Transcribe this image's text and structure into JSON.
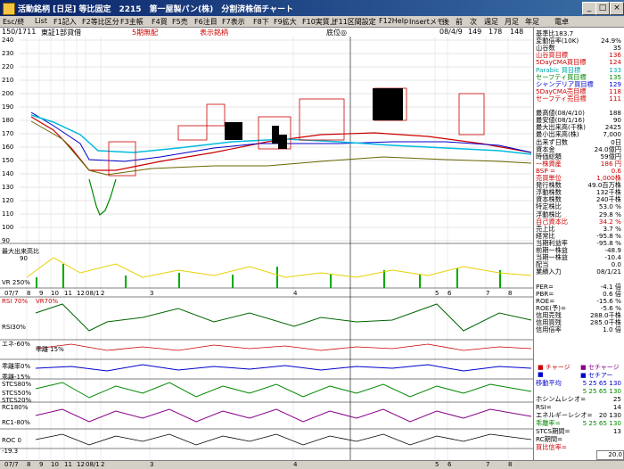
{
  "window": {
    "title": "活動銘柄 [日足] 等比固定　2215　第一屋製パン(株)　分割済株価チャート",
    "buttons": [
      "_",
      "□",
      "×"
    ]
  },
  "menu": [
    "Esc/終",
    "List",
    "F1記入",
    "F2等比区分",
    "F3主帳",
    "F4買",
    "F5売",
    "F6注目",
    "F7表示",
    "F8下",
    "F9拡大",
    "F10実質上",
    "F11区間設定",
    "F12Help",
    "Insertメモ",
    "後",
    "前",
    "次",
    "週足",
    "月足",
    "年足",
    "電卓"
  ],
  "infobar": {
    "count": "150/1711",
    "market": "東証1部貸借",
    "period": "5期無配",
    "display": "表示銘柄",
    "mark": "底位◎",
    "date": "08/4/9",
    "v1": "149",
    "v2": "178",
    "v3": "148",
    "v4": "176",
    "volume": "V:24,258,000"
  },
  "side": {
    "rows": [
      {
        "l": "基準比183.7",
        "v": "",
        "c": "#000000"
      },
      {
        "l": "変動倍率(10K)",
        "v": "24.9%",
        "c": "#000000"
      },
      {
        "l": "山谷数",
        "v": "35",
        "c": "#000000"
      },
      {
        "l": "山谷買目標",
        "v": "136",
        "c": "#cc0000"
      },
      {
        "l": "5DayCMA買目標",
        "v": "124",
        "c": "#cc0000"
      },
      {
        "l": "Parabic 買目標",
        "v": "133",
        "c": "#00aaaa"
      },
      {
        "l": "セーフティ買目標",
        "v": "135",
        "c": "#008800"
      },
      {
        "l": "シャンデリア買目標",
        "v": "129",
        "c": "#0000cc"
      },
      {
        "l": "5DayCMA売目標",
        "v": "118",
        "c": "#cc0000"
      },
      {
        "l": "セーフティ売目標",
        "v": "111",
        "c": "#cc0000"
      },
      {
        "l": "",
        "v": "",
        "c": "#000000"
      },
      {
        "l": "最高値(08/4/10)",
        "v": "188",
        "c": "#000000"
      },
      {
        "l": "最安値(08/1/16)",
        "v": "90",
        "c": "#000000"
      },
      {
        "l": "最大出来高(千株)",
        "v": "2425",
        "c": "#000000"
      },
      {
        "l": "最小出来高(株)",
        "v": "7,000",
        "c": "#000000"
      },
      {
        "l": "出来ず日数",
        "v": "0日",
        "c": "#000000"
      },
      {
        "l": "資本金",
        "v": "24.0億円",
        "c": "#000000"
      },
      {
        "l": "時価総額",
        "v": "59億円",
        "c": "#000000"
      },
      {
        "l": "一株資産",
        "v": "186 円",
        "c": "#cc0000"
      },
      {
        "l": "BSP =",
        "v": "0.6",
        "c": "#cc0000"
      },
      {
        "l": "売買単位",
        "v": "1,000株",
        "c": "#cc0000"
      },
      {
        "l": "発行株数",
        "v": "49.0百万株",
        "c": "#000000"
      },
      {
        "l": "浮動株数",
        "v": "132千株",
        "c": "#000000"
      },
      {
        "l": "資本株数",
        "v": "240千株",
        "c": "#000000"
      },
      {
        "l": "特定株比",
        "v": "53.0 %",
        "c": "#000000"
      },
      {
        "l": "浮動株比",
        "v": "29.8 %",
        "c": "#000000"
      },
      {
        "l": "自己資本比",
        "v": "34.2 %",
        "c": "#cc0000"
      },
      {
        "l": "売上比",
        "v": "3.7 %",
        "c": "#000000"
      },
      {
        "l": "経常比",
        "v": "-95.8 %",
        "c": "#000000"
      },
      {
        "l": "当期利益率",
        "v": "-95.8 %",
        "c": "#000000"
      },
      {
        "l": "前期一株益",
        "v": "-48.9",
        "c": "#000000"
      },
      {
        "l": "当期一株益",
        "v": "-10.4",
        "c": "#000000"
      },
      {
        "l": "配当",
        "v": "0.0",
        "c": "#000000"
      },
      {
        "l": "業績入力",
        "v": "08/1/21",
        "c": "#000000"
      },
      {
        "l": "",
        "v": "",
        "c": "#000000"
      },
      {
        "l": "PER=",
        "v": "-4.1 倍",
        "c": "#000000"
      },
      {
        "l": "PBR=",
        "v": "0.6 倍",
        "c": "#000000"
      },
      {
        "l": "ROE=",
        "v": "-15.6 %",
        "c": "#000000"
      },
      {
        "l": "ROE(予)=",
        "v": "-5.6 %",
        "c": "#000000"
      },
      {
        "l": "信用売残",
        "v": "288.0千株",
        "c": "#000000"
      },
      {
        "l": "信用買残",
        "v": "285.0千株",
        "c": "#000000"
      },
      {
        "l": "信用倍率",
        "v": "1.0 倍",
        "c": "#000000"
      }
    ],
    "legend": [
      {
        "label": "チャージ",
        "color": "#cc0000"
      },
      {
        "label": "セチャージ",
        "color": "#880088"
      },
      {
        "label": "",
        "color": "#0000cc"
      },
      {
        "label": "セチアー",
        "color": "#0000cc"
      }
    ],
    "indicators": [
      {
        "l": "移動平均",
        "v": "5 25 65 130",
        "c": "#0000cc"
      },
      {
        "l": "",
        "v": "5 25 65 130",
        "c": "#008800"
      },
      {
        "l": "ホシンムレシオ=",
        "v": "25",
        "c": "#000000"
      },
      {
        "l": "RSI=",
        "v": "14",
        "c": "#000000"
      },
      {
        "l": "エネルギーレシオ=",
        "v": "20 130",
        "c": "#000000"
      },
      {
        "l": "乖離率=",
        "v": "5 25 65 130",
        "c": "#008800"
      },
      {
        "l": "STCS期間=",
        "v": "13",
        "c": "#000000"
      },
      {
        "l": "RC期間=",
        "v": "",
        "c": "#000000"
      },
      {
        "l": "買比信率=",
        "v": "",
        "c": "#cc0000"
      }
    ],
    "bottom_val": "20.0"
  },
  "price_axis": [
    "240",
    "230",
    "220",
    "210",
    "200",
    "190",
    "180",
    "170",
    "160",
    "150",
    "140",
    "130",
    "120",
    "110",
    "100",
    "90"
  ],
  "panels": {
    "volume": "最大出来高比",
    "volume_val": "90",
    "vr": "VR 250%",
    "dates1": [
      "07/7",
      "8",
      "9",
      "10",
      "11",
      "12",
      "08/1",
      "2",
      "3",
      "4",
      "5",
      "6",
      "7",
      "8"
    ],
    "rsi": "RSI 70%",
    "rsi2": "VR70%",
    "rsi30": "RSI30%",
    "ene": "エネ-60%",
    "dev": "乖離 15%",
    "kairi0": "乖離率0%",
    "kairi15": "乖離-15%",
    "stcs80": "STCS80%",
    "stcs50": "STCS50%",
    "stcs20": "STCS20%",
    "rc180": "RC180%",
    "rc180b": "RC1-80%",
    "roc0": "ROC 0",
    "roc193": "-19.3",
    "dates2": [
      "07/7",
      "8",
      "9",
      "10",
      "11",
      "12",
      "08/1",
      "2",
      "3",
      "4",
      "5",
      "6",
      "7",
      "8"
    ]
  }
}
